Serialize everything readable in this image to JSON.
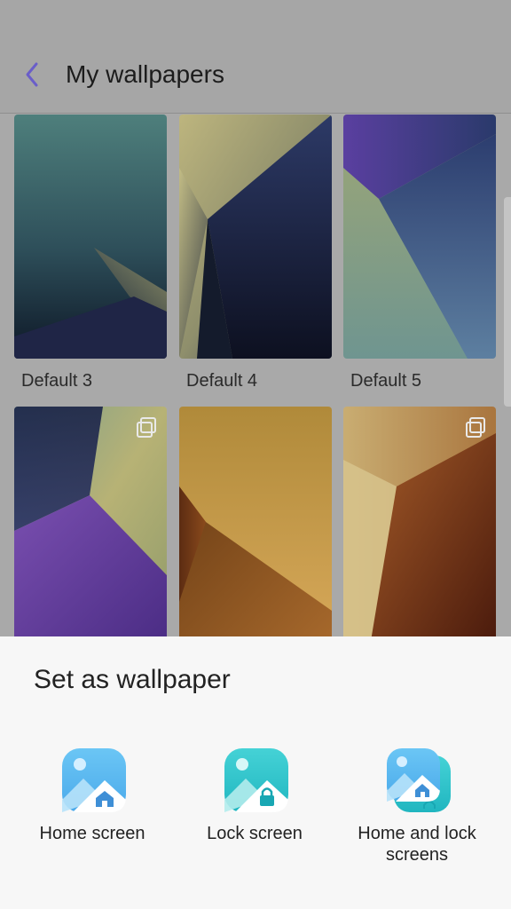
{
  "header": {
    "title": "My wallpapers",
    "back_icon": "chevron-left-icon",
    "back_color": "#6a5ec9"
  },
  "wallpapers": [
    {
      "label": "Default 3"
    },
    {
      "label": "Default 4"
    },
    {
      "label": "Default 5"
    },
    {
      "label": ""
    },
    {
      "label": ""
    },
    {
      "label": ""
    }
  ],
  "sheet": {
    "title": "Set as wallpaper",
    "options": [
      {
        "label": "Home screen",
        "icon": "home-screen-icon"
      },
      {
        "label": "Lock screen",
        "icon": "lock-screen-icon"
      },
      {
        "label": "Home and lock screens",
        "icon": "home-and-lock-screens-icon"
      }
    ]
  },
  "colors": {
    "overlay": "#a6a6a6",
    "sheet_bg": "#f7f7f7",
    "icon_blue": "#5ab8f0",
    "icon_teal": "#2bc3c9"
  }
}
